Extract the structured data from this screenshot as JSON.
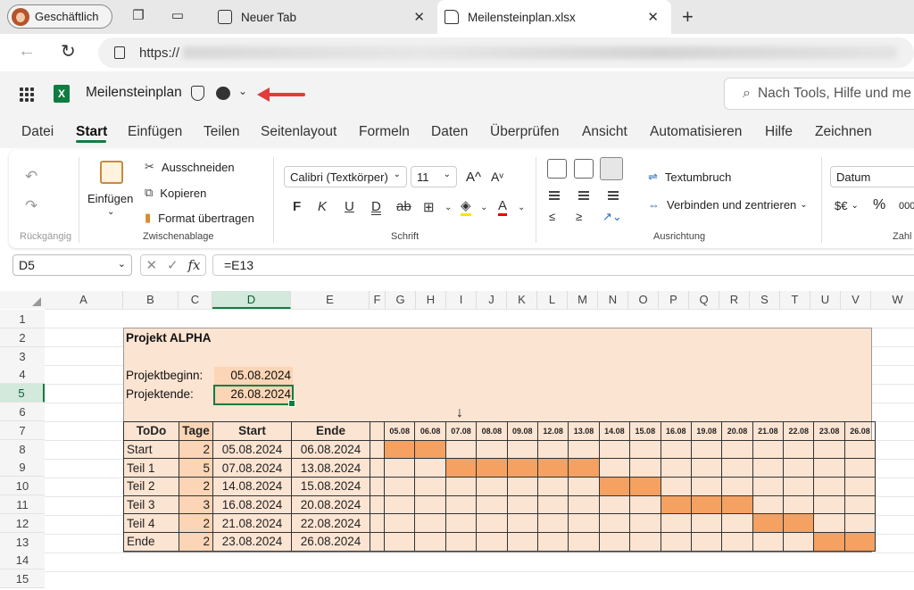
{
  "browser": {
    "profile_label": "Geschäftlich",
    "tabs": [
      {
        "label": "Neuer Tab",
        "active": false
      },
      {
        "label": "Meilensteinplan.xlsx",
        "active": true
      }
    ],
    "url_prefix": "https://"
  },
  "app": {
    "title": "Meilensteinplan",
    "logo_letter": "X",
    "search_placeholder": "Nach Tools, Hilfe und me",
    "brand_color": "#107c41"
  },
  "ribbon_tabs": [
    "Datei",
    "Start",
    "Einfügen",
    "Teilen",
    "Seitenlayout",
    "Formeln",
    "Daten",
    "Überprüfen",
    "Ansicht",
    "Automatisieren",
    "Hilfe",
    "Zeichnen"
  ],
  "ribbon": {
    "undo_group": "Rückgängig",
    "paste_label": "Einfügen",
    "cut_label": "Ausschneiden",
    "copy_label": "Kopieren",
    "format_painter_label": "Format übertragen",
    "clipboard_group": "Zwischenablage",
    "font_name": "Calibri (Textkörper)",
    "font_size": "11",
    "font_group": "Schrift",
    "wrap_label": "Textumbruch",
    "merge_label": "Verbinden und zentrieren",
    "alignment_group": "Ausrichtung",
    "number_format": "Datum",
    "number_group": "Zahl",
    "currency_label": "$€",
    "percent_label": "%",
    "thousands_label": "000",
    "bold": "F",
    "italic": "K",
    "underline": "U",
    "double_underline": "D",
    "strike": "ab",
    "font_grow": "A^",
    "font_shrink": "Aᵛ",
    "font_color": "A"
  },
  "formula_bar": {
    "cell_ref": "D5",
    "formula": "=E13",
    "fx": "fx"
  },
  "sheet": {
    "columns": [
      "A",
      "B",
      "C",
      "D",
      "E",
      "F",
      "G",
      "H",
      "I",
      "J",
      "K",
      "L",
      "M",
      "N",
      "O",
      "P",
      "Q",
      "R",
      "S",
      "T",
      "U",
      "V",
      "W"
    ],
    "rows": [
      "1",
      "2",
      "3",
      "4",
      "5",
      "6",
      "7",
      "8",
      "9",
      "10",
      "11",
      "12",
      "13",
      "14",
      "15"
    ],
    "selected_column": "D",
    "selected_row": "5",
    "project_title": "Projekt ALPHA",
    "start_label": "Projektbeginn:",
    "start_value": "05.08.2024",
    "end_label": "Projektende:",
    "end_value": "26.08.2024",
    "table_headers": [
      "ToDo",
      "Tage",
      "Start",
      "Ende"
    ],
    "timeline_dates": [
      "05.08",
      "06.08",
      "07.08",
      "08.08",
      "09.08",
      "12.08",
      "13.08",
      "14.08",
      "15.08",
      "16.08",
      "19.08",
      "20.08",
      "21.08",
      "22.08",
      "23.08",
      "26.08"
    ],
    "today_marker": "↓",
    "tasks": [
      {
        "todo": "Start",
        "days": "2",
        "start": "05.08.2024",
        "end": "06.08.2024",
        "bar": [
          0,
          1
        ]
      },
      {
        "todo": "Teil 1",
        "days": "5",
        "start": "07.08.2024",
        "end": "13.08.2024",
        "bar": [
          2,
          6
        ]
      },
      {
        "todo": "Teil 2",
        "days": "2",
        "start": "14.08.2024",
        "end": "15.08.2024",
        "bar": [
          7,
          8
        ]
      },
      {
        "todo": "Teil 3",
        "days": "3",
        "start": "16.08.2024",
        "end": "20.08.2024",
        "bar": [
          9,
          11
        ]
      },
      {
        "todo": "Teil 4",
        "days": "2",
        "start": "21.08.2024",
        "end": "22.08.2024",
        "bar": [
          12,
          13
        ]
      },
      {
        "todo": "Ende",
        "days": "2",
        "start": "23.08.2024",
        "end": "26.08.2024",
        "bar": [
          14,
          15
        ]
      }
    ],
    "colors": {
      "bar": "#f4a161",
      "background": "#fce4d2",
      "days": "#fbd5b5"
    }
  }
}
